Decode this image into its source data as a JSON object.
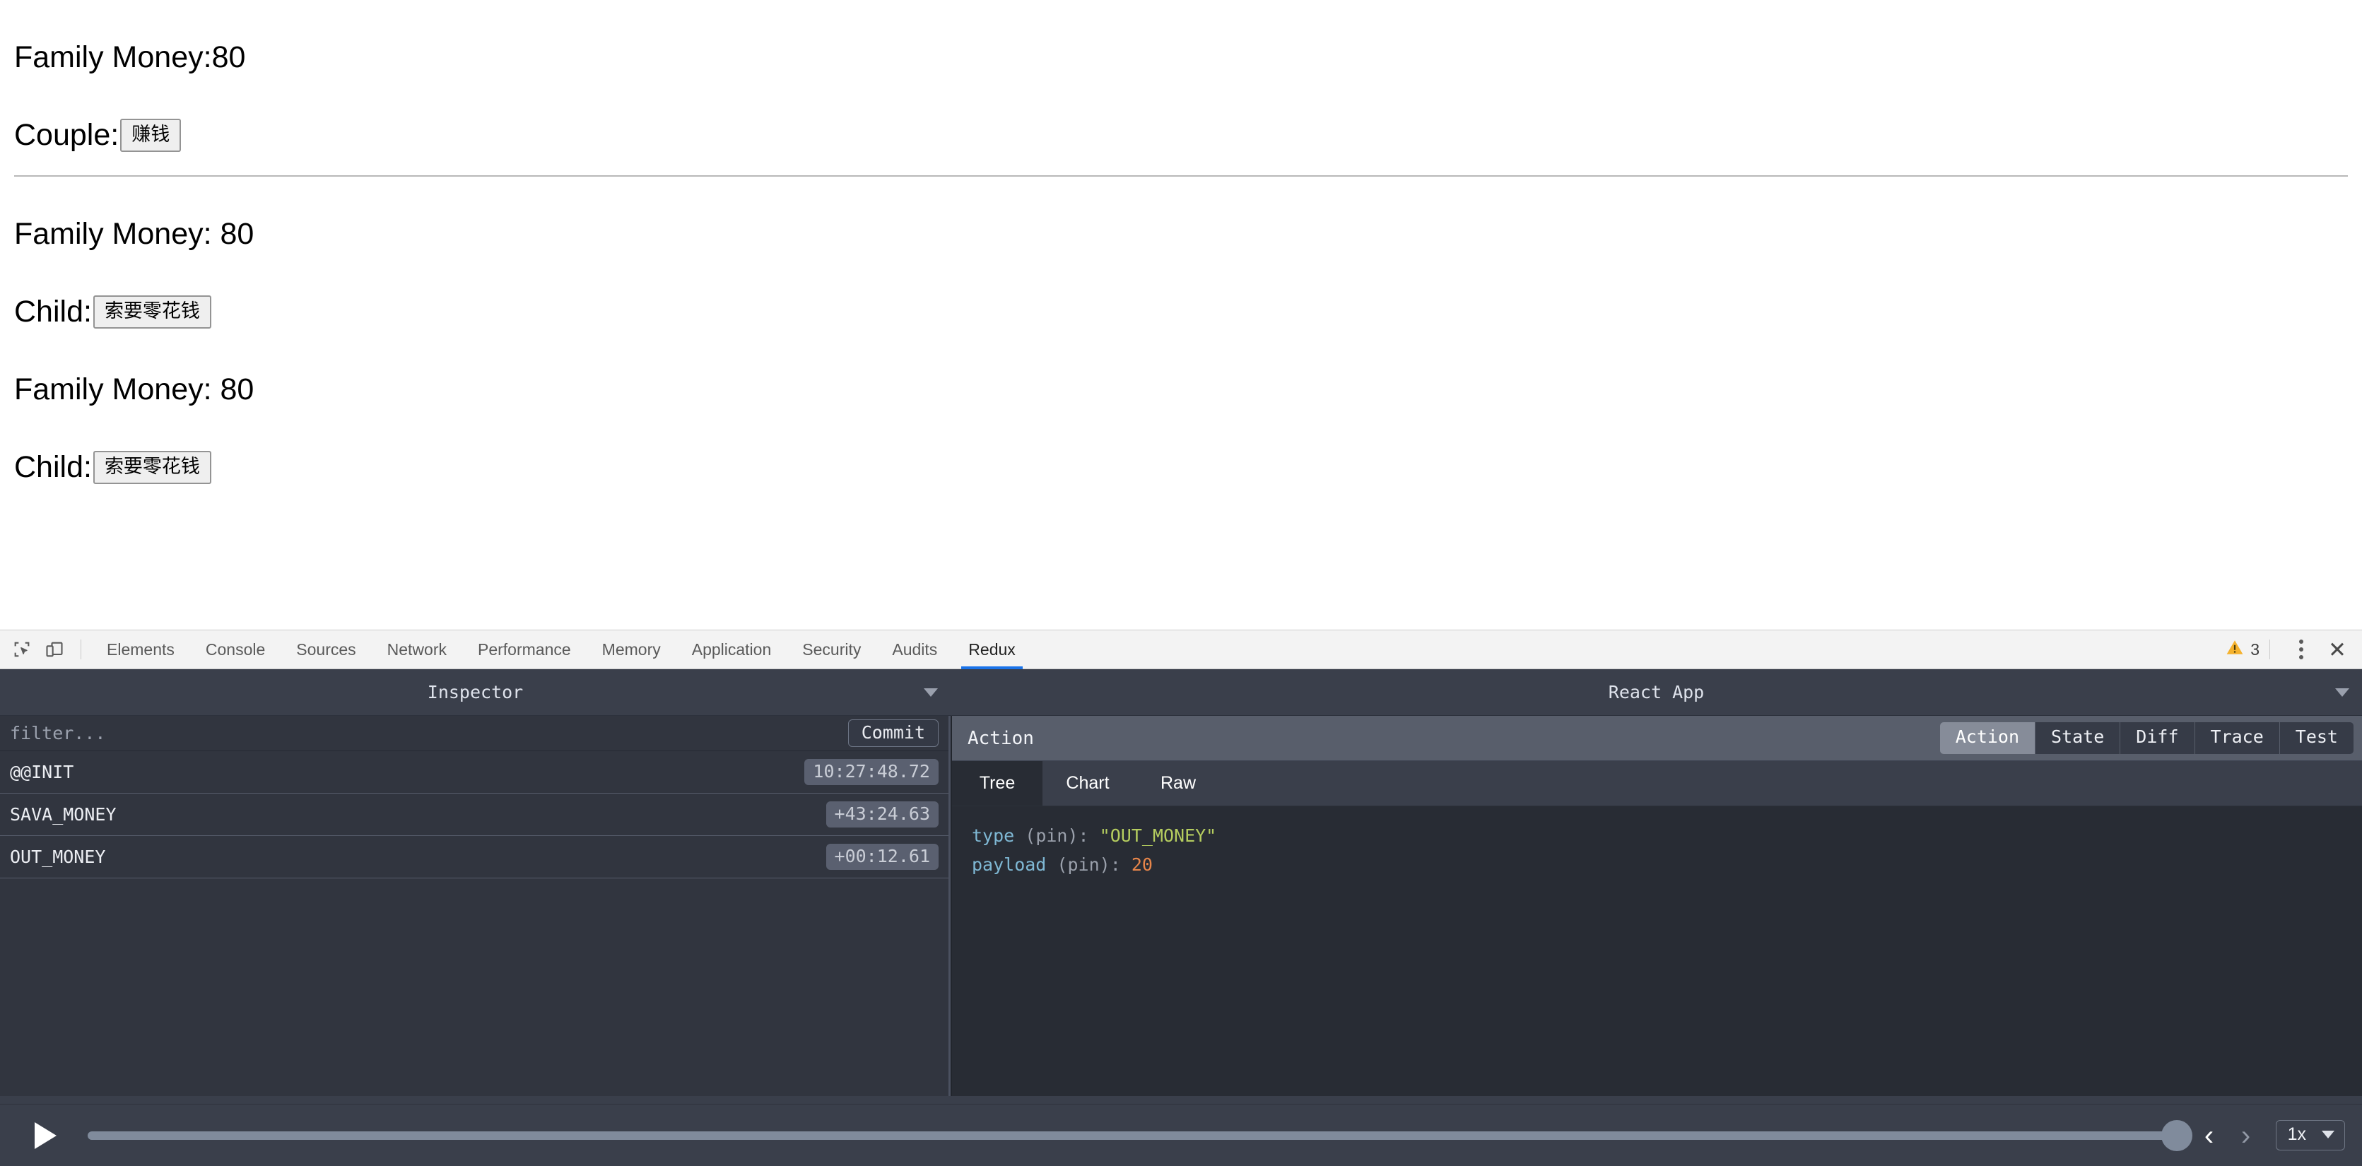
{
  "page": {
    "money_line_1": "Family Money:80",
    "couple_label": "Couple:",
    "couple_button": "赚钱",
    "money_line_2": "Family Money: 80",
    "child_label_1": "Child:",
    "child_button_1": "索要零花钱",
    "money_line_3": "Family Money: 80",
    "child_label_2": "Child:",
    "child_button_2": "索要零花钱"
  },
  "devtools": {
    "tabs": [
      {
        "label": "Elements",
        "active": false
      },
      {
        "label": "Console",
        "active": false
      },
      {
        "label": "Sources",
        "active": false
      },
      {
        "label": "Network",
        "active": false
      },
      {
        "label": "Performance",
        "active": false
      },
      {
        "label": "Memory",
        "active": false
      },
      {
        "label": "Application",
        "active": false
      },
      {
        "label": "Security",
        "active": false
      },
      {
        "label": "Audits",
        "active": false
      },
      {
        "label": "Redux",
        "active": true
      }
    ],
    "warning_count": "3",
    "close_glyph": "✕",
    "icons": {
      "inspect": "inspect-element-icon",
      "device": "device-toolbar-icon",
      "warning": "warning-triangle-icon",
      "menu": "kebab-menu-icon",
      "close": "close-icon"
    }
  },
  "redux": {
    "inspector_title": "Inspector",
    "instance_title": "React App",
    "filter_placeholder": "filter...",
    "filter_value": "",
    "commit_label": "Commit",
    "actions": [
      {
        "name": "@@INIT",
        "time": "10:27:48.72"
      },
      {
        "name": "SAVA_MONEY",
        "time": "+43:24.63"
      },
      {
        "name": "OUT_MONEY",
        "time": "+00:12.61"
      }
    ],
    "action_bar_title": "Action",
    "modes": [
      {
        "label": "Action",
        "active": true
      },
      {
        "label": "State",
        "active": false
      },
      {
        "label": "Diff",
        "active": false
      },
      {
        "label": "Trace",
        "active": false
      },
      {
        "label": "Test",
        "active": false
      }
    ],
    "sub_tabs": [
      {
        "label": "Tree",
        "active": true
      },
      {
        "label": "Chart",
        "active": false
      },
      {
        "label": "Raw",
        "active": false
      }
    ],
    "tree": [
      {
        "key": "type",
        "pin": "(pin)",
        "value": "\"OUT_MONEY\"",
        "value_kind": "string"
      },
      {
        "key": "payload",
        "pin": "(pin)",
        "value": "20",
        "value_kind": "number"
      }
    ]
  },
  "player": {
    "play_icon": "play-icon",
    "prev_icon": "chevron-left-icon",
    "next_icon": "chevron-right-icon",
    "prev_glyph": "‹",
    "next_glyph": "›",
    "speed": "1x",
    "slider_position_percent": 100
  },
  "colors": {
    "accent_tab": "#1a73e8",
    "panel_bg": "#3a3f4b",
    "tree_bg": "#282c34",
    "string_value": "#b5cd5f",
    "number_value": "#e8864a",
    "key_color": "#7fb8d4",
    "warning": "#f5b22d"
  }
}
